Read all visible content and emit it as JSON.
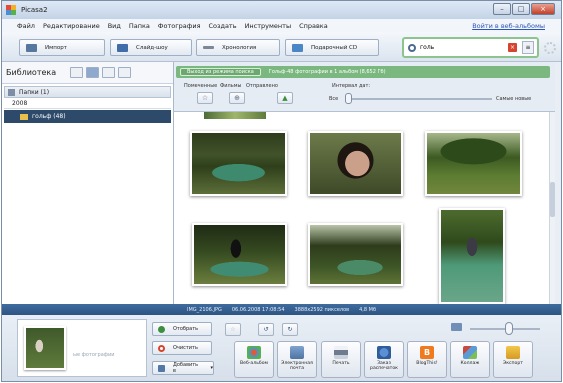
{
  "window": {
    "title": "Picasa2"
  },
  "menu": {
    "items": [
      "Файл",
      "Редактирование",
      "Вид",
      "Папка",
      "Фотография",
      "Создать",
      "Инструменты",
      "Справка"
    ],
    "web_link": "Войти в веб-альбомы"
  },
  "toolbar": {
    "import_label": "Импорт",
    "slideshow_label": "Слайд-шоу",
    "timeline_label": "Хронология",
    "giftcd_label": "Подарочный CD",
    "search_value": "голь",
    "clear_symbol": "×",
    "options_symbol": "≡"
  },
  "library": {
    "label": "Библиотека",
    "folders_label": "Папки (1)",
    "year_label": "2008",
    "album_label": "гольф (48)"
  },
  "filter": {
    "back_label": "Выход из режима поиска",
    "info": "Гольф-48 фотографии в 1 альбом (8,652 Гб)",
    "starred_label": "Помеченные",
    "movies_label": "Фильмы",
    "uploaded_label": "Отправлено",
    "interval_label": "Интервал дат:",
    "all_label": "Все",
    "newest_label": "Самые новые"
  },
  "status": {
    "filename": "IMG_2106.JPG",
    "date": "06.06.2008 17:08:54",
    "dimensions": "3888x2592 пикселов",
    "size": "4,8 Мб"
  },
  "tray": {
    "hold_label": "Отобрать",
    "clear_label": "Очистить",
    "add_label": "Добавить в",
    "hint": "ые фотографии",
    "actions": [
      "Веб-альбом",
      "Электронная почта",
      "Печать",
      "Заказ распечаток",
      "BlogThis!",
      "Коллаж",
      "Экспорт"
    ]
  },
  "colors": {
    "accent_green": "#7bb87f",
    "selection": "#2e4a6b",
    "status_bar": "#2d5583",
    "close_button": "#c3402a"
  }
}
